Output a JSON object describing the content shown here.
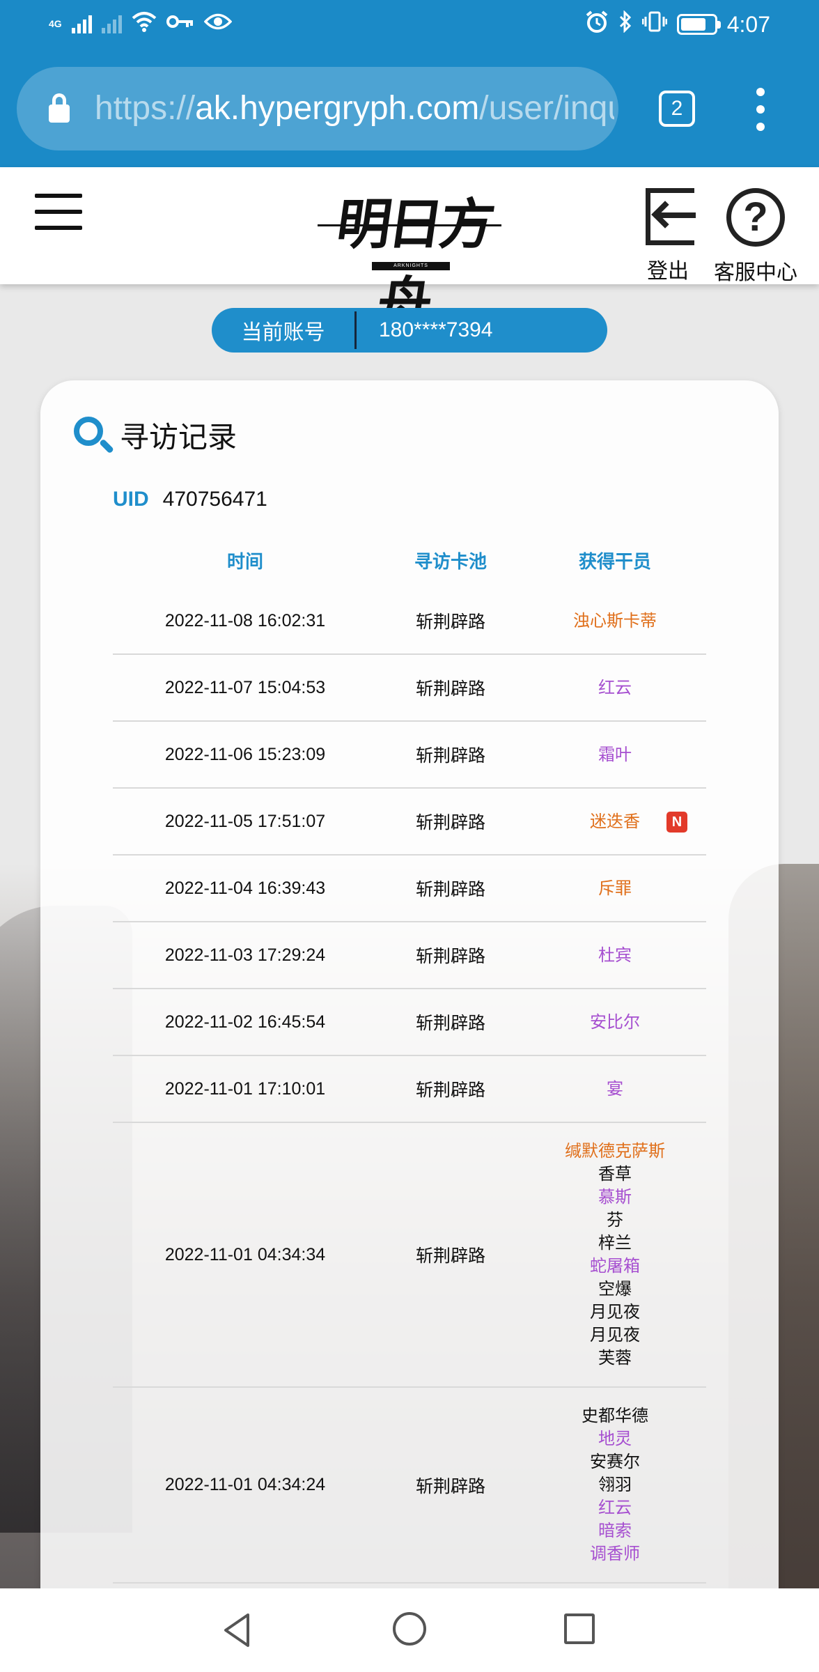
{
  "status_bar": {
    "network_label": "4G",
    "time": "4:07",
    "battery_level": 0.75,
    "icons": [
      "signal-icon",
      "wifi-icon",
      "key-icon",
      "eye-icon",
      "alarm-icon",
      "bluetooth-icon",
      "vibrate-icon",
      "battery-icon"
    ]
  },
  "browser": {
    "url_scheme": "https://",
    "url_host": "ak.hypergryph.com",
    "url_path": "/user/inquiry",
    "tab_count": "2"
  },
  "header": {
    "logo_text": "明日方舟",
    "logo_sub": "ARKNIGHTS",
    "logout_label": "登出",
    "help_label": "客服中心"
  },
  "account": {
    "label": "当前账号",
    "value": "180****7394"
  },
  "card": {
    "title": "寻访记录",
    "uid_label": "UID",
    "uid_value": "470756471"
  },
  "table": {
    "headers": {
      "time": "时间",
      "pool": "寻访卡池",
      "operator": "获得干员"
    },
    "rows": [
      {
        "time": "2022-11-08 16:02:31",
        "pool": "斩荆辟路",
        "operators": [
          {
            "name": "浊心斯卡蒂",
            "color": "orange"
          }
        ]
      },
      {
        "time": "2022-11-07 15:04:53",
        "pool": "斩荆辟路",
        "operators": [
          {
            "name": "红云",
            "color": "purple"
          }
        ]
      },
      {
        "time": "2022-11-06 15:23:09",
        "pool": "斩荆辟路",
        "operators": [
          {
            "name": "霜叶",
            "color": "purple"
          }
        ]
      },
      {
        "time": "2022-11-05 17:51:07",
        "pool": "斩荆辟路",
        "operators": [
          {
            "name": "迷迭香",
            "color": "orange",
            "badge": "N"
          }
        ]
      },
      {
        "time": "2022-11-04 16:39:43",
        "pool": "斩荆辟路",
        "operators": [
          {
            "name": "斥罪",
            "color": "orange"
          }
        ]
      },
      {
        "time": "2022-11-03 17:29:24",
        "pool": "斩荆辟路",
        "operators": [
          {
            "name": "杜宾",
            "color": "purple"
          }
        ]
      },
      {
        "time": "2022-11-02 16:45:54",
        "pool": "斩荆辟路",
        "operators": [
          {
            "name": "安比尔",
            "color": "purple"
          }
        ]
      },
      {
        "time": "2022-11-01 17:10:01",
        "pool": "斩荆辟路",
        "operators": [
          {
            "name": "宴",
            "color": "purple"
          }
        ]
      },
      {
        "time": "2022-11-01 04:34:34",
        "pool": "斩荆辟路",
        "operators": [
          {
            "name": "缄默德克萨斯",
            "color": "orange"
          },
          {
            "name": "香草",
            "color": "black"
          },
          {
            "name": "慕斯",
            "color": "purple"
          },
          {
            "name": "芬",
            "color": "black"
          },
          {
            "name": "梓兰",
            "color": "black"
          },
          {
            "name": "蛇屠箱",
            "color": "purple"
          },
          {
            "name": "空爆",
            "color": "black"
          },
          {
            "name": "月见夜",
            "color": "black"
          },
          {
            "name": "月见夜",
            "color": "black"
          },
          {
            "name": "芙蓉",
            "color": "black"
          }
        ]
      },
      {
        "time": "2022-11-01 04:34:24",
        "pool": "斩荆辟路",
        "operators": [
          {
            "name": "史都华德",
            "color": "black"
          },
          {
            "name": "地灵",
            "color": "purple"
          },
          {
            "name": "安赛尔",
            "color": "black"
          },
          {
            "name": "翎羽",
            "color": "black"
          },
          {
            "name": "红云",
            "color": "purple"
          },
          {
            "name": "暗索",
            "color": "purple"
          },
          {
            "name": "调香师",
            "color": "purple"
          }
        ]
      }
    ]
  },
  "colors": {
    "brand": "#1b8ac7",
    "accent": "#1f8ecb",
    "rarity_orange": "#e0701c",
    "rarity_purple": "#a64fd0",
    "new_badge": "#e23a2a"
  }
}
